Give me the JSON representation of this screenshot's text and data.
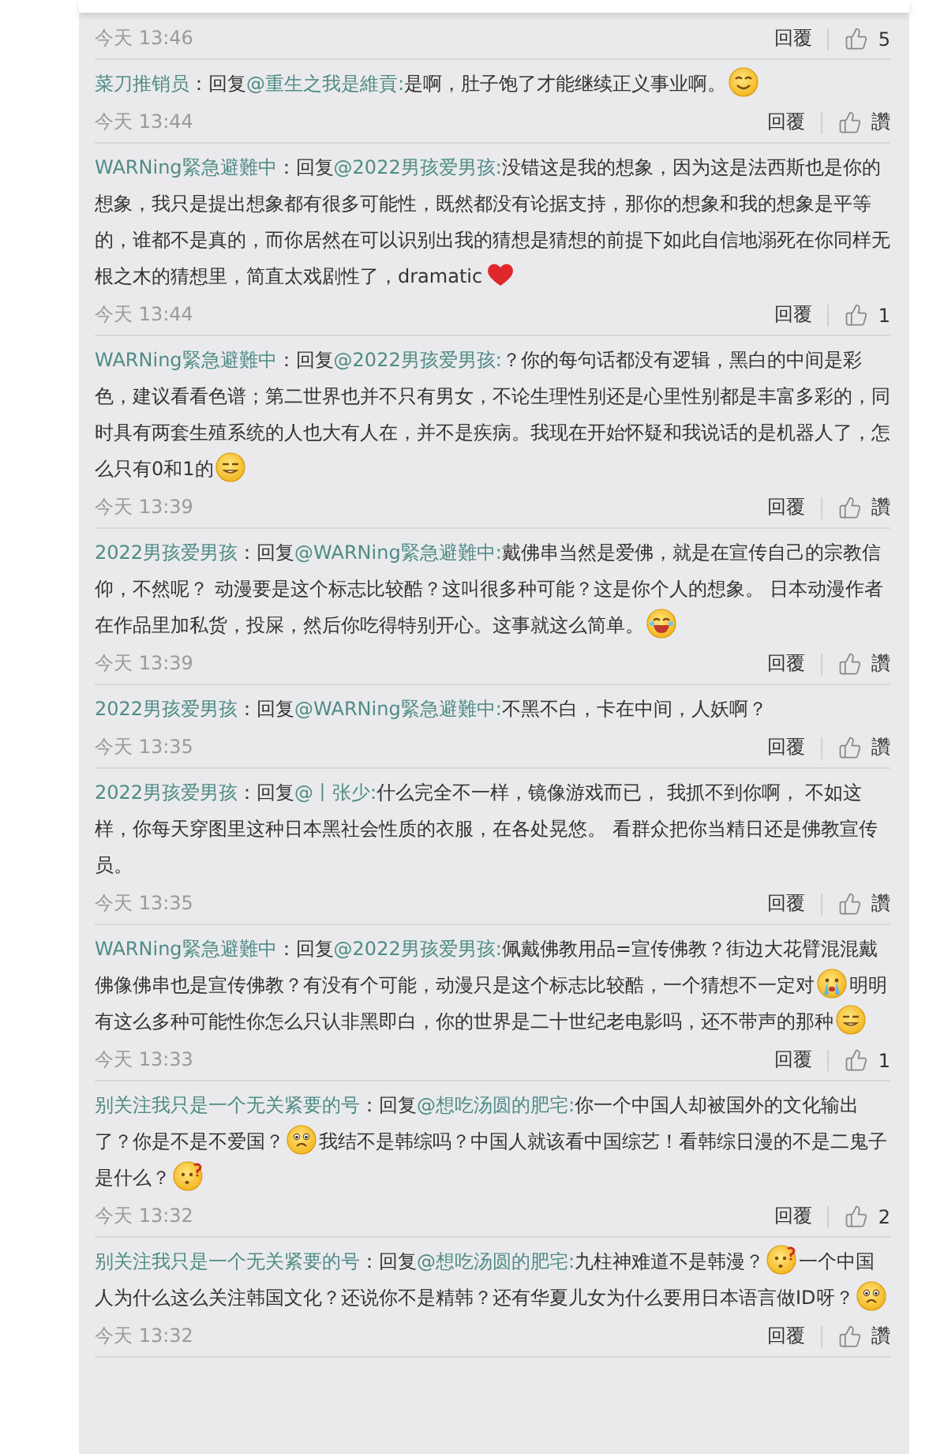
{
  "comments": [
    {
      "time": "今天 13:46",
      "reply": "回覆",
      "likes": "5"
    },
    {
      "author": "菜刀推销员",
      "reply_prefix": "：回复",
      "mention": "@重生之我是維貢:",
      "body": [
        {
          "kind": "text",
          "text": "是啊，肚子饱了才能继续正义事业啊。"
        },
        {
          "kind": "smile"
        }
      ],
      "time": "今天 13:44",
      "reply": "回覆",
      "likes": "讚"
    },
    {
      "author": "WARNing緊急避難中",
      "reply_prefix": "：回复",
      "mention": "@2022男孩爱男孩:",
      "body": [
        {
          "kind": "text",
          "text": "没错这是我的想象，因为这是法西斯也是你的想象，我只是提出想象都有很多可能性，既然都没有论据支持，那你的想象和我的想象是平等的，谁都不是真的，而你居然在可以识别出我的猜想是猜想的前提下如此自信地溺死在你同样无根之木的猜想里，简直太戏剧性了，dramatic"
        },
        {
          "kind": "heart"
        }
      ],
      "time": "今天 13:44",
      "reply": "回覆",
      "likes": "1"
    },
    {
      "author": "WARNing緊急避難中",
      "reply_prefix": "：回复",
      "mention": "@2022男孩爱男孩:",
      "body": [
        {
          "kind": "text",
          "text": "？你的每句话都没有逻辑，黑白的中间是彩色，建议看看色谱；第二世界也并不只有男女，不论生理性别还是心里性别都是丰富多彩的，同时具有两套生殖系统的人也大有人在，并不是疾病。我现在开始怀疑和我说话的是机器人了，怎么只有0和1的"
        },
        {
          "kind": "dizzy"
        }
      ],
      "time": "今天 13:39",
      "reply": "回覆",
      "likes": "讚"
    },
    {
      "author": "2022男孩爱男孩",
      "reply_prefix": "：回复",
      "mention": "@WARNing緊急避難中:",
      "body": [
        {
          "kind": "text",
          "text": "戴佛串当然是爱佛，就是在宣传自己的宗教信仰，不然呢？ 动漫要是这个标志比较酷？这叫很多种可能？这是你个人的想象。 日本动漫作者在作品里加私货，投屎，然后你吃得特别开心。这事就这么简单。"
        },
        {
          "kind": "laugh"
        }
      ],
      "time": "今天 13:39",
      "reply": "回覆",
      "likes": "讚"
    },
    {
      "author": "2022男孩爱男孩",
      "reply_prefix": "：回复",
      "mention": "@WARNing緊急避難中:",
      "body": [
        {
          "kind": "text",
          "text": "不黑不白，卡在中间，人妖啊？"
        }
      ],
      "time": "今天 13:35",
      "reply": "回覆",
      "likes": "讚"
    },
    {
      "author": "2022男孩爱男孩",
      "reply_prefix": "：回复",
      "mention": "@丨张少:",
      "body": [
        {
          "kind": "text",
          "text": "什么完全不一样，镜像游戏而已， 我抓不到你啊， 不如这样，你每天穿图里这种日本黑社会性质的衣服，在各处晃悠。 看群众把你当精日还是佛教宣传员。"
        }
      ],
      "time": "今天 13:35",
      "reply": "回覆",
      "likes": "讚"
    },
    {
      "author": "WARNing緊急避難中",
      "reply_prefix": "：回复",
      "mention": "@2022男孩爱男孩:",
      "body": [
        {
          "kind": "text",
          "text": "佩戴佛教用品=宣传佛教？街边大花臂混混戴佛像佛串也是宣传佛教？有没有个可能，动漫只是这个标志比较酷，一个猜想不一定对"
        },
        {
          "kind": "cry"
        },
        {
          "kind": "text",
          "text": "明明有这么多种可能性你怎么只认非黑即白，你的世界是二十世纪老电影吗，还不带声的那种"
        },
        {
          "kind": "dizzy"
        }
      ],
      "time": "今天 13:33",
      "reply": "回覆",
      "likes": "1"
    },
    {
      "author": "别关注我只是一个无关紧要的号",
      "reply_prefix": "：回复",
      "mention": "@想吃汤圆的肥宅:",
      "body": [
        {
          "kind": "text",
          "text": "你一个中国人却被国外的文化输出了？你是不是不爱国？"
        },
        {
          "kind": "sad"
        },
        {
          "kind": "text",
          "text": "我结不是韩综吗？中国人就该看中国综艺！看韩综日漫的不是二鬼子是什么？"
        },
        {
          "kind": "puzzled"
        }
      ],
      "time": "今天 13:32",
      "reply": "回覆",
      "likes": "2"
    },
    {
      "author": "别关注我只是一个无关紧要的号",
      "reply_prefix": "：回复",
      "mention": "@想吃汤圆的肥宅:",
      "body": [
        {
          "kind": "text",
          "text": "九柱神难道不是韩漫？"
        },
        {
          "kind": "puzzled"
        },
        {
          "kind": "text",
          "text": "一个中国人为什么这么关注韩国文化？还说你不是精韩？还有华夏儿女为什么要用日本语言做ID呀？"
        },
        {
          "kind": "sad"
        }
      ],
      "time": "今天 13:32",
      "reply": "回覆",
      "likes": "讚"
    }
  ]
}
